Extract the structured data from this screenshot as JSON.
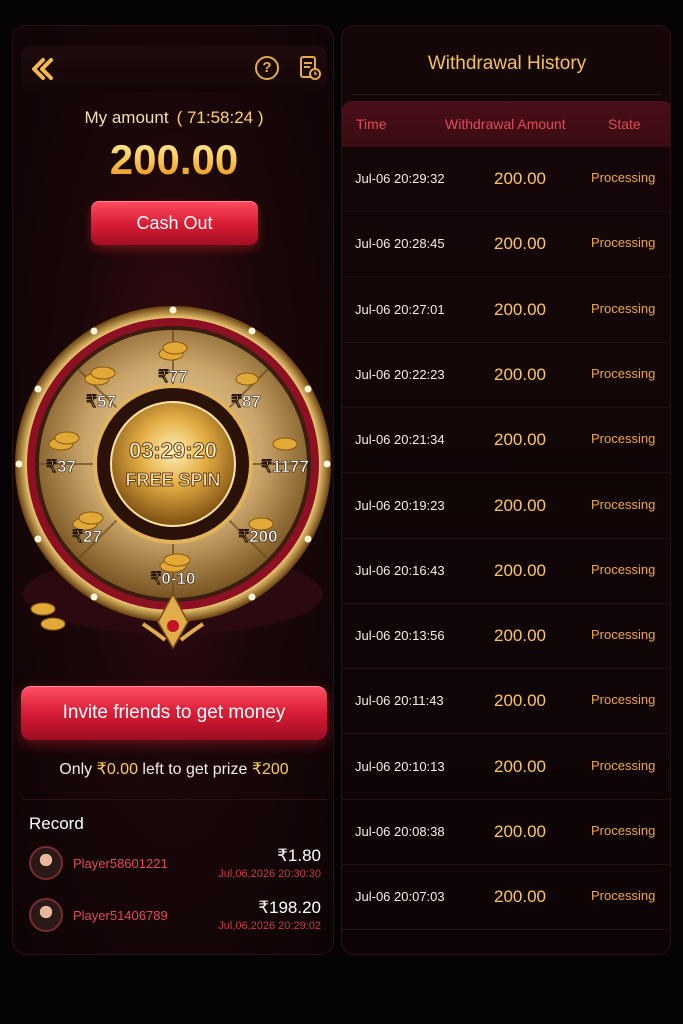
{
  "left": {
    "amount_label": "My amount",
    "timer": "( 71:58:24 )",
    "amount": "200.00",
    "cashout_label": "Cash Out",
    "wheel": {
      "center_timer": "03:29:20",
      "center_label": "FREE SPIN",
      "prizes": [
        "₹77",
        "₹87",
        "₹1177",
        "₹200",
        "₹0-10",
        "₹27",
        "₹37",
        "₹57"
      ]
    },
    "invite_label": "Invite friends to get money",
    "prize_line": {
      "prefix": "Only",
      "left_amount": "₹0.00",
      "middle": "left to get prize",
      "prize": "₹200"
    },
    "record_title": "Record",
    "records": [
      {
        "name": "Player58601221",
        "amount": "₹1.80",
        "date": "Jul,06,2026 20:30:30"
      },
      {
        "name": "Player51406789",
        "amount": "₹198.20",
        "date": "Jul,06,2026 20:29:02"
      }
    ]
  },
  "history": {
    "title": "Withdrawal History",
    "columns": [
      "Time",
      "Withdrawal Amount",
      "State"
    ],
    "rows": [
      {
        "time": "Jul-06 20:29:32",
        "amount": "200.00",
        "state": "Processing"
      },
      {
        "time": "Jul-06 20:28:45",
        "amount": "200.00",
        "state": "Processing"
      },
      {
        "time": "Jul-06 20:27:01",
        "amount": "200.00",
        "state": "Processing"
      },
      {
        "time": "Jul-06 20:22:23",
        "amount": "200.00",
        "state": "Processing"
      },
      {
        "time": "Jul-06 20:21:34",
        "amount": "200.00",
        "state": "Processing"
      },
      {
        "time": "Jul-06 20:19:23",
        "amount": "200.00",
        "state": "Processing"
      },
      {
        "time": "Jul-06 20:16:43",
        "amount": "200.00",
        "state": "Processing"
      },
      {
        "time": "Jul-06 20:13:56",
        "amount": "200.00",
        "state": "Processing"
      },
      {
        "time": "Jul-06 20:11:43",
        "amount": "200.00",
        "state": "Processing"
      },
      {
        "time": "Jul-06 20:10:13",
        "amount": "200.00",
        "state": "Processing"
      },
      {
        "time": "Jul-06 20:08:38",
        "amount": "200.00",
        "state": "Processing"
      },
      {
        "time": "Jul-06 20:07:03",
        "amount": "200.00",
        "state": "Processing"
      }
    ]
  },
  "colors": {
    "gold": "#ffc75a",
    "red": "#d61b33",
    "state": "#f0a640"
  },
  "icons": {
    "back": "back-chevron-icon",
    "help": "help-icon",
    "history": "history-document-icon"
  }
}
